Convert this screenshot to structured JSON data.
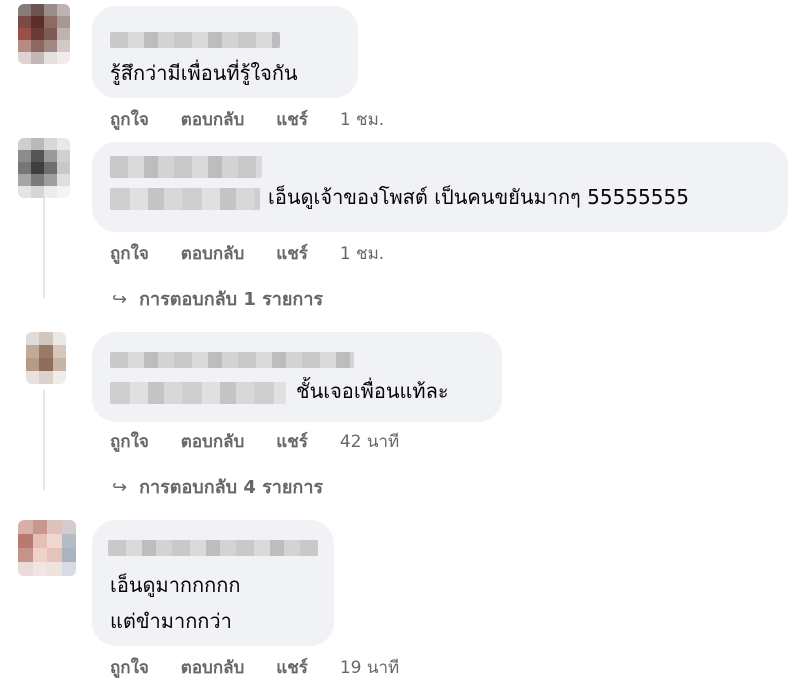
{
  "comments": [
    {
      "text": "รู้สึกว่ามีเพื่อนที่รู้ใจกัน",
      "actions": {
        "like": "ถูกใจ",
        "reply": "ตอบกลับ",
        "share": "แชร์",
        "time": "1 ชม."
      }
    },
    {
      "text": "เอ็นดูเจ้าของโพสต์ เป็นคนขยันมากๆ 55555555",
      "actions": {
        "like": "ถูกใจ",
        "reply": "ตอบกลับ",
        "share": "แชร์",
        "time": "1 ชม."
      },
      "replies": {
        "arrow": "↪",
        "label": "การตอบกลับ 1 รายการ"
      }
    },
    {
      "text": "ชั้นเจอเพื่อนแท้ละ",
      "actions": {
        "like": "ถูกใจ",
        "reply": "ตอบกลับ",
        "share": "แชร์",
        "time": "42 นาที"
      },
      "replies": {
        "arrow": "↪",
        "label": "การตอบกลับ 4 รายการ"
      }
    },
    {
      "text_line1": "เอ็นดูมากกกกก",
      "text_line2": "แต่ขำมากกว่า",
      "actions": {
        "like": "ถูกใจ",
        "reply": "ตอบกลับ",
        "share": "แชร์",
        "time": "19 นาที"
      }
    }
  ]
}
